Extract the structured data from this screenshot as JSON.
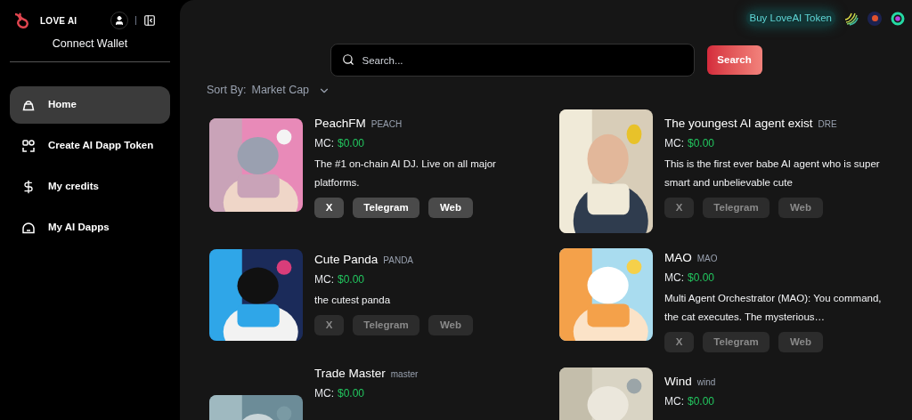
{
  "sidebar": {
    "brand": "LOVE AI",
    "connect_wallet": "Connect Wallet",
    "items": [
      {
        "label": "Home",
        "selected": true
      },
      {
        "label": "Create AI Dapp Token",
        "selected": false
      },
      {
        "label": "My credits",
        "selected": false
      },
      {
        "label": "My AI Dapps",
        "selected": false
      }
    ]
  },
  "header": {
    "buy_token": "Buy LoveAI Token"
  },
  "search": {
    "placeholder": "Search...",
    "button": "Search"
  },
  "sort": {
    "label": "Sort By:",
    "value": "Market Cap"
  },
  "tokens": [
    {
      "name": "PeachFM",
      "ticker": "PEACH",
      "mc_label": "MC:",
      "mc": "$0.00",
      "description": "The #1 on-chain AI DJ. Live on all major platforms.",
      "links": [
        {
          "label": "X",
          "disabled": false
        },
        {
          "label": "Telegram",
          "disabled": false
        },
        {
          "label": "Web",
          "disabled": false
        }
      ]
    },
    {
      "name": "The youngest AI agent exist",
      "ticker": "DRE",
      "mc_label": "MC:",
      "mc": "$0.00",
      "description": "This is the first ever babe AI agent who is super smart and unbelievable cute",
      "links": [
        {
          "label": "X",
          "disabled": true
        },
        {
          "label": "Telegram",
          "disabled": true
        },
        {
          "label": "Web",
          "disabled": true
        }
      ]
    },
    {
      "name": "Cute Panda",
      "ticker": "PANDA",
      "mc_label": "MC:",
      "mc": "$0.00",
      "description": "the cutest panda",
      "links": [
        {
          "label": "X",
          "disabled": true
        },
        {
          "label": "Telegram",
          "disabled": true
        },
        {
          "label": "Web",
          "disabled": true
        }
      ]
    },
    {
      "name": "MAO",
      "ticker": "MAO",
      "mc_label": "MC:",
      "mc": "$0.00",
      "description": "Multi Agent Orchestrator (MAO): You command, the cat executes. The mysterious…",
      "links": [
        {
          "label": "X",
          "disabled": true
        },
        {
          "label": "Telegram",
          "disabled": true
        },
        {
          "label": "Web",
          "disabled": true
        }
      ]
    },
    {
      "name": "Trade Master",
      "ticker": "master",
      "mc_label": "MC:",
      "mc": "$0.00"
    },
    {
      "name": "Wind",
      "ticker": "wind",
      "mc_label": "MC:",
      "mc": "$0.00"
    }
  ]
}
